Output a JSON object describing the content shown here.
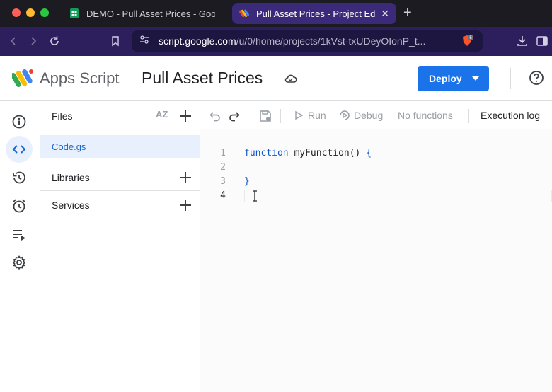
{
  "browser": {
    "tabs": [
      {
        "title": "DEMO - Pull Asset Prices - Googl",
        "active": false,
        "favicon": "sheets-icon"
      },
      {
        "title": "Pull Asset Prices - Project Ed",
        "active": true,
        "favicon": "apps-script-icon"
      }
    ],
    "close_glyph": "✕",
    "new_tab_glyph": "+",
    "url_host": "script.google.com",
    "url_path": "/u/0/home/projects/1kVst-txUDeyOIonP_t...",
    "shield_badge": "5"
  },
  "header": {
    "app_name": "Apps Script",
    "project_name": "Pull Asset Prices",
    "deploy_label": "Deploy"
  },
  "files_panel": {
    "files_label": "Files",
    "sort_label": "AZ",
    "files": [
      "Code.gs"
    ],
    "libraries_label": "Libraries",
    "services_label": "Services"
  },
  "toolbar": {
    "run_label": "Run",
    "debug_label": "Debug",
    "function_select": "No functions",
    "execution_log_label": "Execution log"
  },
  "editor": {
    "line_numbers": [
      "1",
      "2",
      "3",
      "4"
    ],
    "active_line": "4",
    "keyword": "function",
    "function_name": " myFunction() ",
    "open_brace": "{",
    "close_brace": "}"
  },
  "colors": {
    "accent": "#1a73e8",
    "selected_bg": "#e8f0fe",
    "active_tab": "#3b2a7a",
    "nav_bg": "#2d1f5e"
  }
}
